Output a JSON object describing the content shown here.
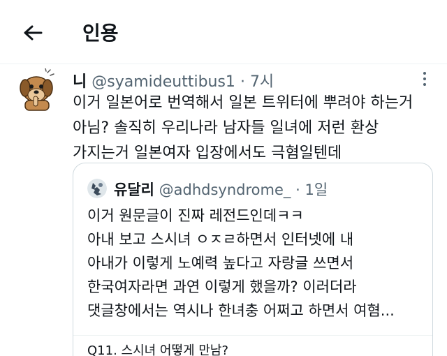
{
  "header": {
    "title": "인용",
    "back_icon": "arrow-left-icon"
  },
  "tweet": {
    "name": "니",
    "handle": "@syamideuttibus1",
    "separator": "·",
    "time": "7시",
    "more_icon": "more-vertical-icon",
    "lines": [
      "이거 일본어로 번역해서 일본 트위터에 뿌려야 하는거",
      "아님? 솔직히 우리나라 남자들 일녀에 저런 환상",
      "가지는거 일본여자 입장에서도 극혐일텐데"
    ]
  },
  "quote": {
    "name": "유달리",
    "handle": "@adhdsyndrome_",
    "separator": "·",
    "time": "1일",
    "lines": [
      "이거 원문글이 진짜 레전드인데ㅋㅋ",
      "아내 보고 스시녀 ㅇㅈㄹ하면서 인터넷에 내",
      "아내가 이렇게 노예력 높다고 자랑글 쓰면서",
      "한국여자라면 과연 이렇게 했을까? 이러더라",
      "댓글창에서는 역시나 한녀충 어쩌고 하면서 여혐..."
    ],
    "poll_text": "Q11. 스시녀 어떻게 만남?"
  },
  "colors": {
    "text": "#0f1419",
    "secondary": "#536471",
    "border": "#cfd9de"
  }
}
